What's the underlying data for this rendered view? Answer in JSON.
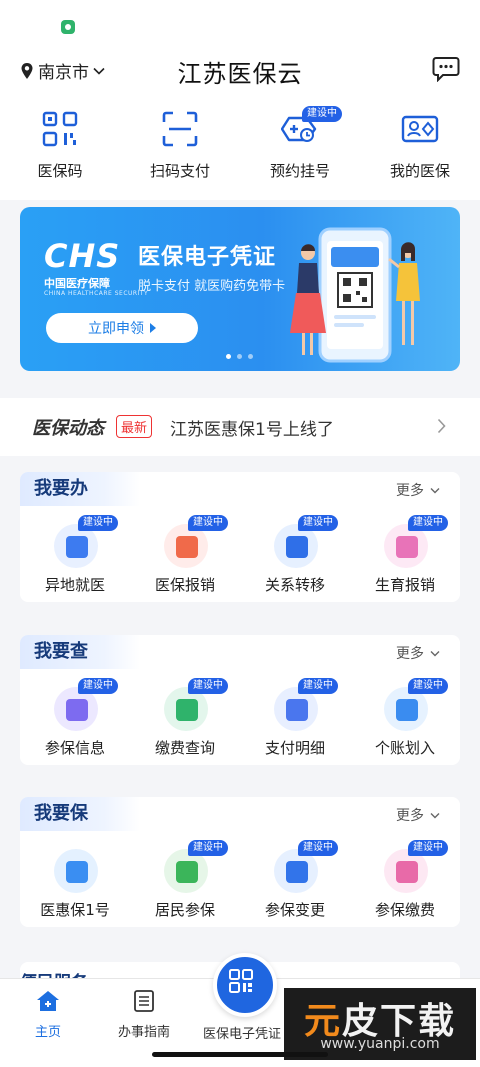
{
  "header": {
    "location": "南京市",
    "title": "江苏医保云"
  },
  "quick_actions": [
    {
      "label": "医保码",
      "icon": "qr-code-icon"
    },
    {
      "label": "扫码支付",
      "icon": "scan-icon"
    },
    {
      "label": "预约挂号",
      "icon": "appointment-icon",
      "badge": "建设中"
    },
    {
      "label": "我的医保",
      "icon": "card-icon"
    }
  ],
  "banner": {
    "logo_text": "CHS",
    "logo_sub_cn": "中国医疗保障",
    "logo_sub_en": "CHINA HEALTHCARE SECURITY",
    "title": "医保电子凭证",
    "subtitle": "脱卡支付 就医购药免带卡",
    "button": "立即申领"
  },
  "news": {
    "logo": "医保动态",
    "tag": "最新",
    "text": "江苏医惠保1号上线了"
  },
  "sections": [
    {
      "title": "我要办",
      "more": "更多",
      "items": [
        {
          "label": "异地就医",
          "icon": "remote-medical-icon",
          "badge": "建设中",
          "bg": "#e8f0ff",
          "fg": "#3d7bf0"
        },
        {
          "label": "医保报销",
          "icon": "reimbursement-icon",
          "badge": "建设中",
          "bg": "#ffecea",
          "fg": "#f06a4a"
        },
        {
          "label": "关系转移",
          "icon": "transfer-icon",
          "badge": "建设中",
          "bg": "#e6f0ff",
          "fg": "#2f6fe8"
        },
        {
          "label": "生育报销",
          "icon": "maternity-icon",
          "badge": "建设中",
          "bg": "#fde9f5",
          "fg": "#e873b8"
        }
      ]
    },
    {
      "title": "我要查",
      "more": "更多",
      "items": [
        {
          "label": "参保信息",
          "icon": "insurance-info-icon",
          "badge": "建设中",
          "bg": "#ece8ff",
          "fg": "#7d6bf0"
        },
        {
          "label": "缴费查询",
          "icon": "payment-query-icon",
          "badge": "建设中",
          "bg": "#e3f6ec",
          "fg": "#2fb36b"
        },
        {
          "label": "支付明细",
          "icon": "payment-detail-icon",
          "badge": "建设中",
          "bg": "#e8efff",
          "fg": "#4a76ee"
        },
        {
          "label": "个账划入",
          "icon": "account-transfer-icon",
          "badge": "建设中",
          "bg": "#e6f2ff",
          "fg": "#3a8cf0"
        }
      ]
    },
    {
      "title": "我要保",
      "more": "更多",
      "items": [
        {
          "label": "医惠保1号",
          "icon": "yihuibao-icon",
          "bg": "#e4f1ff",
          "fg": "#3a8ef2"
        },
        {
          "label": "居民参保",
          "icon": "resident-insurance-icon",
          "badge": "建设中",
          "bg": "#e6f6e8",
          "fg": "#3bb55a"
        },
        {
          "label": "参保变更",
          "icon": "insurance-change-icon",
          "badge": "建设中",
          "bg": "#e6f0ff",
          "fg": "#3274ea"
        },
        {
          "label": "参保缴费",
          "icon": "insurance-payment-icon",
          "badge": "建设中",
          "bg": "#fde8f3",
          "fg": "#e86aa8"
        }
      ]
    }
  ],
  "peek_section": "便民服务",
  "tabbar": {
    "home": "主页",
    "guide": "办事指南",
    "center": "医保电子凭证"
  },
  "watermark": {
    "line1_a": "元",
    "line1_b": "皮下载",
    "line2": "www.yuanpi.com"
  }
}
